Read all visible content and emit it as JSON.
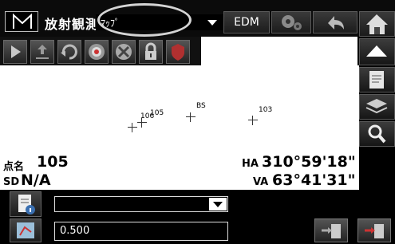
{
  "header": {
    "menu_icon": "m-menu-icon",
    "title": "放射観測",
    "mode_value": "ﾏｯﾌﾟ",
    "edm_label": "EDM",
    "config_icon": "gear-icon",
    "back_icon": "return-arrow-icon",
    "home_icon": "home-icon"
  },
  "toolbar": {
    "tools": [
      "play-icon",
      "move-icon",
      "rotate-icon",
      "target-icon",
      "compass-icon",
      "lock-icon",
      "shield-icon"
    ]
  },
  "map": {
    "points": [
      {
        "name": "106"
      },
      {
        "name": "105"
      },
      {
        "name": "BS"
      },
      {
        "name": "103"
      }
    ]
  },
  "sidebar": {
    "buttons": [
      "up-arrow-icon",
      "note-icon",
      "layers-icon",
      "zoom-icon"
    ]
  },
  "readout": {
    "point_label": "点名",
    "point_value": "105",
    "sd_label": "SD",
    "sd_value": "N/A",
    "ha_label": "HA",
    "ha_value": "310°59'18\"",
    "va_label": "VA",
    "va_value": "63°41'31\""
  },
  "bottom": {
    "point_select_value": "",
    "value_field": "0.500"
  },
  "colors": {
    "background": "#000000",
    "panel": "#ffffff",
    "button": "#2a2a2a"
  }
}
